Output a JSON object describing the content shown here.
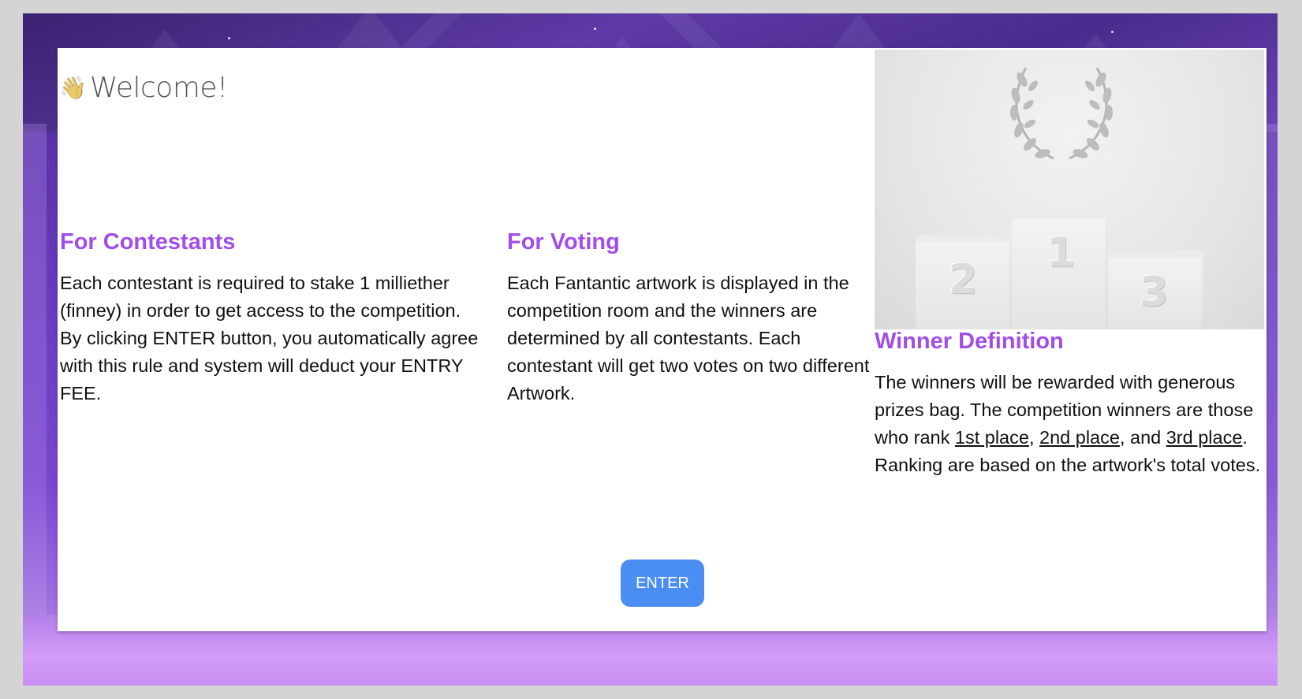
{
  "welcome": {
    "icon": "waving-hand-icon",
    "title": "Welcome!"
  },
  "contestants": {
    "heading": "For Contestants",
    "body": "Each contestant is required to stake 1 milliether (finney) in order to get access to the competition. By clicking ENTER button, you automatically agree with this rule and system will deduct your ENTRY FEE."
  },
  "voting": {
    "heading": "For Voting",
    "body": "Each Fantantic artwork is displayed in the competition room and the winners are determined by all contestants. Each contestant will get two votes on two different Artwork."
  },
  "winner": {
    "heading": "Winner Definition",
    "body_part1": "The winners will be rewarded with generous prizes bag. The competition winners are those who rank ",
    "link_first": "1st place",
    "sep1": ", ",
    "link_second": "2nd place",
    "sep2": ", and ",
    "link_third": "3rd place",
    "body_part2": ". Ranking are based on the artwork's total votes."
  },
  "podium": {
    "icon": "laurel-wreath-icon",
    "place_1": "1",
    "place_2": "2",
    "place_3": "3"
  },
  "enter_button": {
    "label": "ENTER"
  },
  "colors": {
    "heading": "#a14de6",
    "button": "#4a8ef3",
    "background": "#6b3cc0"
  }
}
